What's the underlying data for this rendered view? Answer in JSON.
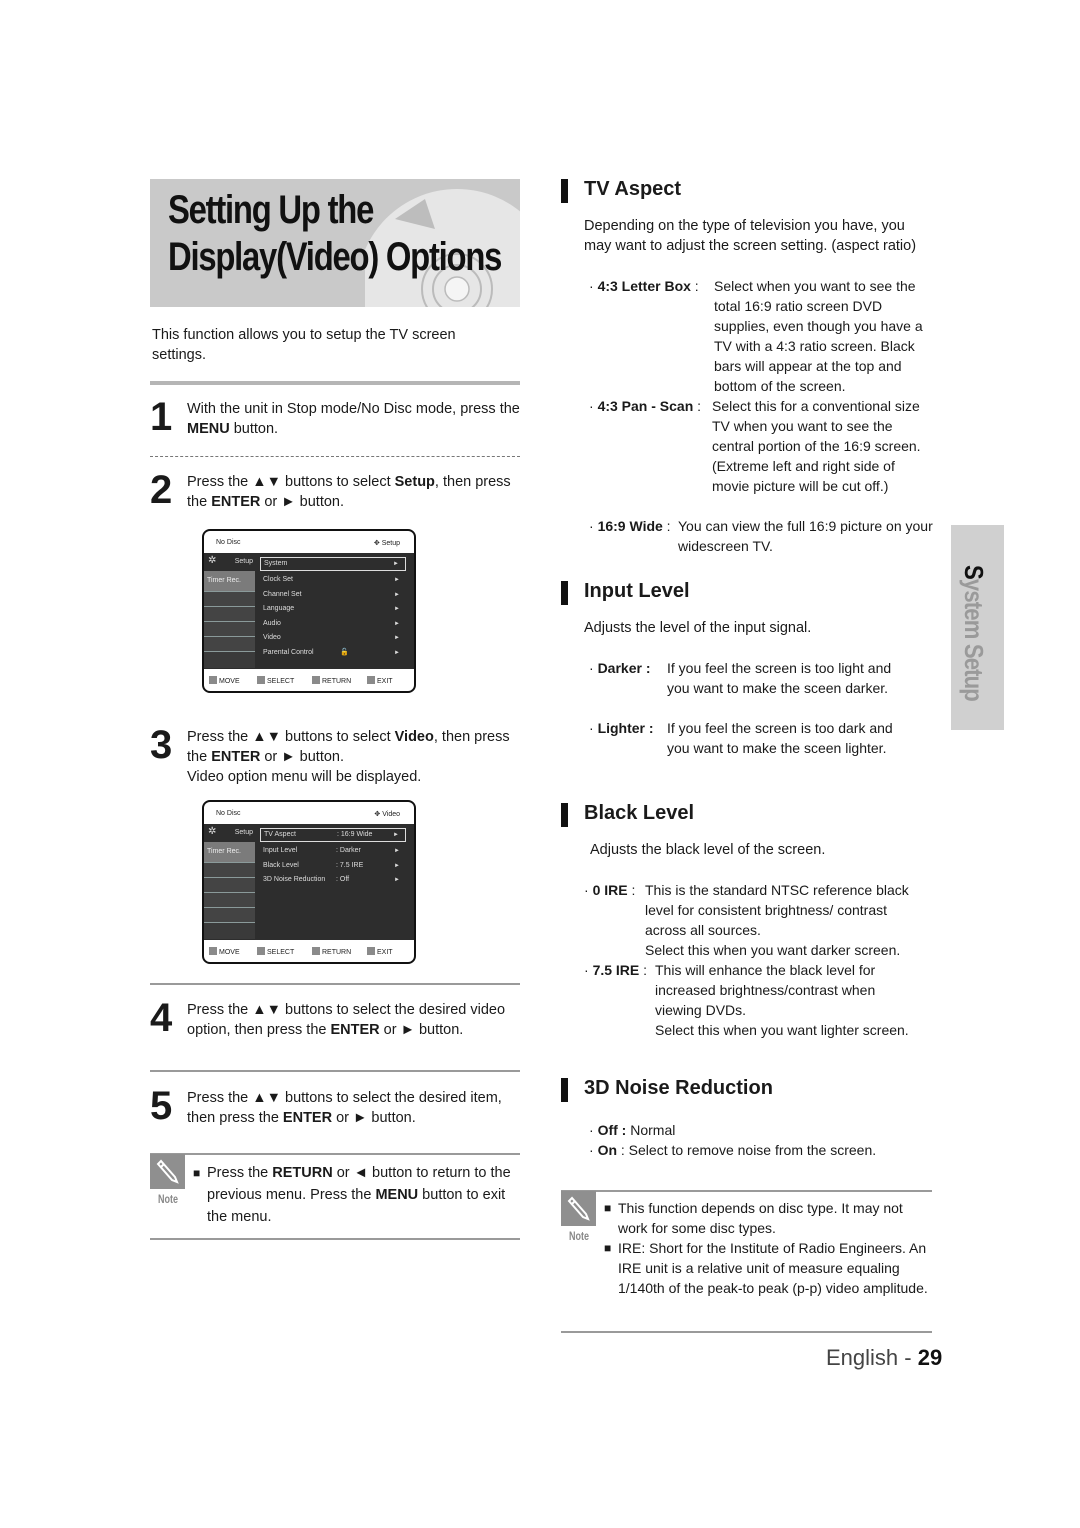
{
  "title": {
    "line1": "Setting Up the",
    "line2": "Display(Video) Options"
  },
  "intro": "This function allows you to setup the TV screen settings.",
  "steps": [
    {
      "num": "1",
      "pre": "With the unit in Stop mode/No Disc mode, press the ",
      "bold1": "MENU",
      "post": " button."
    },
    {
      "num": "2",
      "pre": "Press the ▲▼ buttons to select ",
      "bold1": "Setup",
      "mid": ", then press the ",
      "bold2": "ENTER",
      "post": " or ► button."
    },
    {
      "num": "3",
      "pre": "Press the ▲▼ buttons to select ",
      "bold1": "Video",
      "mid": ", then press the ",
      "bold2": "ENTER",
      "post": " or ► button.",
      "extra": "Video option menu will be displayed."
    },
    {
      "num": "4",
      "pre": "Press the ▲▼ buttons to select the desired video option, then press the ",
      "bold1": "ENTER",
      "post": " or ► button."
    },
    {
      "num": "5",
      "pre": "Press the ▲▼ buttons to select the desired item, then press the ",
      "bold1": "ENTER",
      "post": " or ► button."
    }
  ],
  "menu_setup": {
    "status_left": "No Disc",
    "status_right": "Setup",
    "side": [
      "Setup",
      "Timer Rec."
    ],
    "items": [
      {
        "label": "System"
      },
      {
        "label": "Clock Set"
      },
      {
        "label": "Channel Set"
      },
      {
        "label": "Language"
      },
      {
        "label": "Audio"
      },
      {
        "label": "Video"
      },
      {
        "label": "Parental Control"
      }
    ],
    "footer": [
      "MOVE",
      "SELECT",
      "RETURN",
      "EXIT"
    ]
  },
  "menu_video": {
    "status_left": "No Disc",
    "status_right": "Video",
    "side": [
      "Setup",
      "Timer Rec."
    ],
    "items": [
      {
        "label": "TV Aspect",
        "value": ": 16:9 Wide"
      },
      {
        "label": "Input Level",
        "value": ": Darker"
      },
      {
        "label": "Black Level",
        "value": ": 7.5 IRE"
      },
      {
        "label": "3D Noise Reduction",
        "value": ": Off"
      }
    ],
    "footer": [
      "MOVE",
      "SELECT",
      "RETURN",
      "EXIT"
    ]
  },
  "note_left": {
    "label": "Note",
    "pre": "Press the ",
    "b1": "RETURN",
    "mid": " or ◄ button to return to the previous menu. Press the ",
    "b2": "MENU",
    "post": " button to exit the menu."
  },
  "tv_aspect": {
    "title": "TV Aspect",
    "desc": "Depending on the type of television you have, you may want to adjust the screen setting. (aspect ratio)",
    "options": [
      {
        "key": "4:3 Letter  Box",
        "sep": " : ",
        "desc": "Select when you want to see the total 16:9 ratio screen DVD supplies, even though you have a TV with a 4:3 ratio screen. Black bars will appear at the top and bottom of the screen."
      },
      {
        "key": "4:3 Pan - Scan",
        "sep": " : ",
        "desc": "Select this for a conventional size TV when you want to see the central portion of the 16:9 screen. (Extreme left and right side of movie picture will be cut off.)"
      },
      {
        "key": "16:9 Wide",
        "sep": " : ",
        "desc": "You can view the full 16:9 picture on your widescreen TV."
      }
    ]
  },
  "input_level": {
    "title": "Input Level",
    "desc": "Adjusts the level of the input signal.",
    "options": [
      {
        "key": "Darker :",
        "desc": "If you feel the screen is too light and you want to make the sceen darker."
      },
      {
        "key": "Lighter :",
        "desc": "If you feel the screen is too dark and you want to make the sceen lighter."
      }
    ]
  },
  "black_level": {
    "title": "Black Level",
    "desc": "Adjusts the black level of the screen.",
    "options": [
      {
        "key": "0 IRE",
        "sep": " : ",
        "desc": "This is the standard NTSC reference black level for consistent brightness/ contrast across all sources.",
        "desc2": "Select this when you want darker screen."
      },
      {
        "key": "7.5 IRE",
        "sep": " : ",
        "desc": "This will  enhance the black level for increased brightness/contrast when viewing DVDs.",
        "desc2": "Select this when you want lighter screen."
      }
    ]
  },
  "noise": {
    "title": "3D Noise Reduction",
    "options": [
      {
        "key": "Off :",
        "desc": " Normal"
      },
      {
        "key": "On",
        "desc": " : Select to remove noise from the screen."
      }
    ]
  },
  "note_right": {
    "label": "Note",
    "items": [
      "This function depends on disc type. It may not work for some disc types.",
      "IRE: Short for the Institute of Radio Engineers. An IRE unit is a relative unit of measure equaling 1/140th of the peak-to peak (p-p) video amplitude."
    ]
  },
  "side_tab": {
    "first": "S",
    "rest": "ystem Setup"
  },
  "footer": {
    "lang": "English - ",
    "page": "29"
  }
}
